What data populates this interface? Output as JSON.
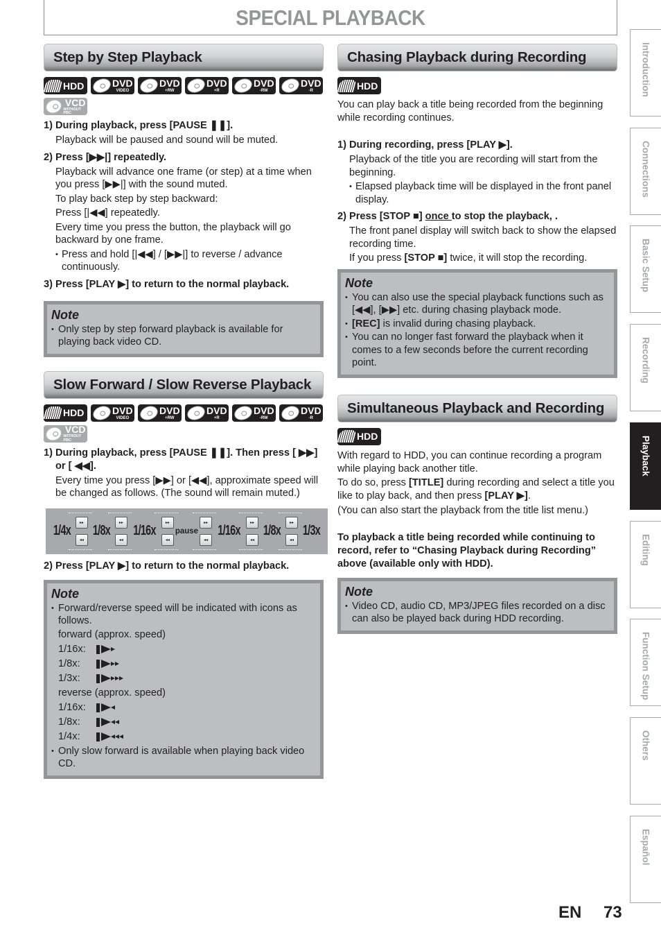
{
  "page": {
    "title": "SPECIAL PLAYBACK",
    "lang_code": "EN",
    "page_number": "73"
  },
  "badges_full": [
    {
      "icon": "hdd-icon",
      "main": "HDD",
      "sub": ""
    },
    {
      "icon": "disc-icon",
      "main": "DVD",
      "sub": "VIDEO"
    },
    {
      "icon": "disc-icon",
      "main": "DVD",
      "sub": "+RW"
    },
    {
      "icon": "disc-icon",
      "main": "DVD",
      "sub": "+R"
    },
    {
      "icon": "disc-icon",
      "main": "DVD",
      "sub": "-RW"
    },
    {
      "icon": "disc-icon",
      "main": "DVD",
      "sub": "-R"
    },
    {
      "icon": "disc-icon",
      "main": "VCD",
      "sub": "WITHOUT PBC"
    }
  ],
  "step_by_step": {
    "header": "Step by Step Playback",
    "step1": {
      "num": "1)",
      "head": "During playback, press [PAUSE ❚❚].",
      "body": "Playback will be paused and sound will be muted."
    },
    "step2": {
      "num": "2)",
      "head": "Press [▶▶|] repeatedly.",
      "body1": "Playback will advance one frame (or step) at a time when you press [▶▶|] with the sound muted.",
      "body2": "To play back step by step backward:",
      "body3": "Press [|◀◀] repeatedly.",
      "body4": "Every time you press the button, the playback will go backward by one frame.",
      "bullet": "Press and hold [|◀◀] / [▶▶|] to reverse / advance continuously."
    },
    "step3": {
      "num": "3)",
      "head": "Press [PLAY ▶] to return to the normal playback."
    },
    "note": {
      "title": "Note",
      "items": [
        "Only step by step forward playback is available for playing back video CD."
      ]
    }
  },
  "slow": {
    "header": "Slow Forward / Slow Reverse Playback",
    "step1": {
      "num": "1)",
      "head": "During playback, press [PAUSE ❚❚]. Then press [ ▶▶] or [ ◀◀].",
      "body": "Every time you press [▶▶] or [◀◀], approximate speed will be changed as follows. (The sound will remain muted.)"
    },
    "speeds": {
      "s1": "1/4x",
      "s2": "1/8x",
      "s3": "1/16x",
      "pause": "pause",
      "s4": "1/16x",
      "s5": "1/8x",
      "s6": "1/3x",
      "fwd_btn": "▸▸",
      "rev_btn": "◂◂"
    },
    "step2": {
      "num": "2)",
      "head": "Press [PLAY ▶] to return to the normal playback."
    },
    "note": {
      "title": "Note",
      "item1": "Forward/reverse speed will be indicated with icons as follows.",
      "forward_label": "forward (approx. speed)",
      "forward": [
        {
          "label": "1/16x:",
          "arrows": 1
        },
        {
          "label": "1/8x:",
          "arrows": 2
        },
        {
          "label": "1/3x:",
          "arrows": 3
        }
      ],
      "reverse_label": "reverse (approx. speed)",
      "reverse": [
        {
          "label": "1/16x:",
          "arrows": 1
        },
        {
          "label": "1/8x:",
          "arrows": 2
        },
        {
          "label": "1/4x:",
          "arrows": 3
        }
      ],
      "item2": "Only slow forward is available when playing back video CD."
    }
  },
  "chasing": {
    "header": "Chasing Playback during Recording",
    "badge": {
      "main": "HDD"
    },
    "intro": "You can play back a title being recorded from the beginning while recording continues.",
    "step1": {
      "num": "1)",
      "head": "During recording, press [PLAY ▶].",
      "body": "Playback of the title you are recording will start from the beginning.",
      "bullet": "Elapsed playback time will be displayed in the front panel display."
    },
    "step2": {
      "num": "2)",
      "head_a": "Press [STOP ■] ",
      "head_u": "once ",
      "head_b": "to stop the playback, .",
      "body1": "The front panel display will switch back to show the elapsed recording time.",
      "body2_a": "If you press ",
      "body2_k": "[STOP ■]",
      "body2_b": " twice, it will stop the recording."
    },
    "note": {
      "title": "Note",
      "item1": "You can also use the special playback functions such as [◀◀], [▶▶] etc. during chasing playback mode.",
      "item2_k": "[REC]",
      "item2": " is invalid during chasing playback.",
      "item3": "You can no longer fast forward the playback when it comes to a few seconds before the current recording point."
    }
  },
  "simultaneous": {
    "header": "Simultaneous Playback and Recording",
    "badge": {
      "main": "HDD"
    },
    "p1": "With regard to HDD, you can continue recording a program while playing back another title.",
    "p2_a": "To do so, press ",
    "p2_k1": "[TITLE]",
    "p2_b": " during recording and select a title you like to play back, and then press ",
    "p2_k2": "[PLAY ▶]",
    "p2_c": ".",
    "p3": "(You can also start the playback from the title list menu.)",
    "bold_para": "To playback a title being recorded while continuing to record, refer to “Chasing Playback during Recording” above (available only with HDD).",
    "note": {
      "title": "Note",
      "item1": "Video CD, audio CD, MP3/JPEG files recorded on a disc can also be played back during HDD recording."
    }
  },
  "side_tabs": [
    {
      "label": "Introduction",
      "active": false
    },
    {
      "label": "Connections",
      "active": false
    },
    {
      "label": "Basic Setup",
      "active": false
    },
    {
      "label": "Recording",
      "active": false
    },
    {
      "label": "Playback",
      "active": true
    },
    {
      "label": "Editing",
      "active": false
    },
    {
      "label": "Function Setup",
      "active": false
    },
    {
      "label": "Others",
      "active": false
    },
    {
      "label": "Español",
      "active": false
    }
  ]
}
